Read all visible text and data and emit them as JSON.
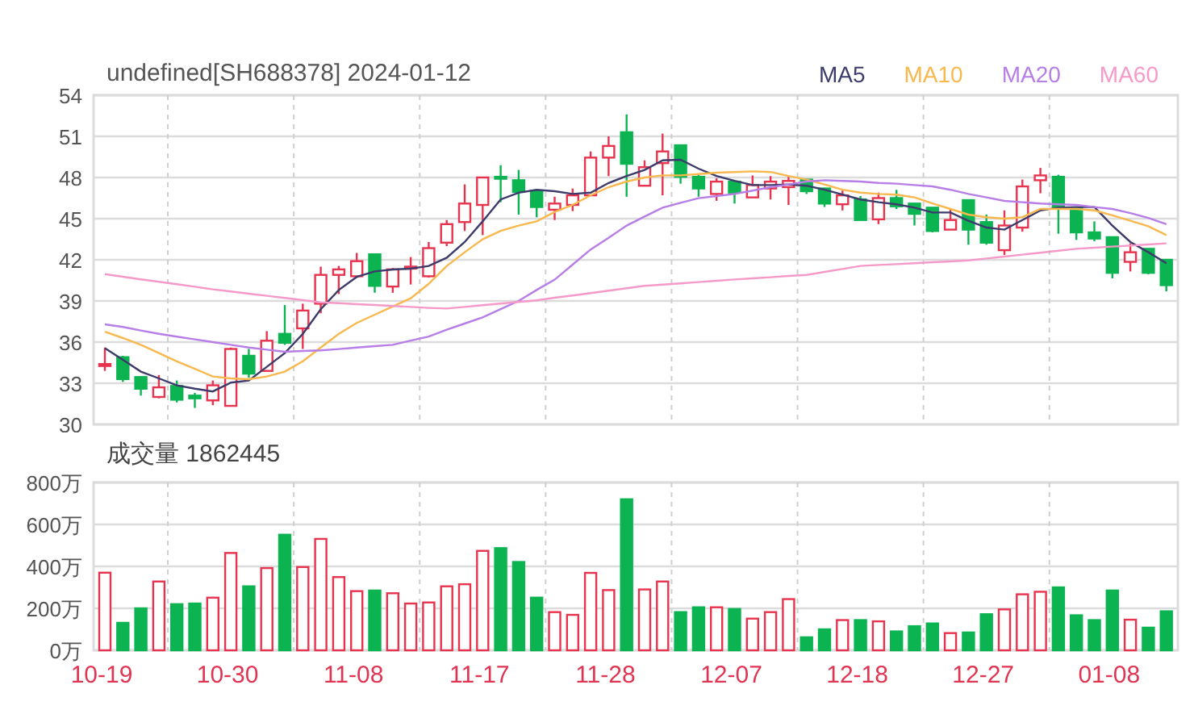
{
  "header": {
    "title": "undefined[SH688378] 2024-01-12"
  },
  "price_chart": {
    "chart_data": {
      "type": "candlestick",
      "grid": true,
      "categories": [
        null,
        null,
        null,
        null,
        null,
        null,
        null,
        null,
        null,
        null,
        null,
        null,
        null,
        null,
        null,
        null,
        null,
        null,
        null,
        null,
        null,
        null,
        null,
        null,
        null,
        null,
        null,
        null,
        null,
        null,
        null,
        null,
        null,
        null,
        null,
        null,
        null,
        null,
        null,
        null,
        null,
        null,
        null,
        null,
        null,
        null,
        null,
        null,
        null,
        null,
        null,
        null,
        null,
        null,
        null,
        null,
        null,
        null,
        null,
        null
      ],
      "ylim": [
        30,
        54
      ],
      "yticks": [
        30,
        33,
        36,
        39,
        42,
        45,
        48,
        51,
        54
      ],
      "series": [
        {
          "name": "MA5",
          "type": "line",
          "color": "#3d3b6b",
          "values": [
            35.55,
            34.7,
            33.85,
            33.35,
            32.85,
            32.6,
            32.4,
            33.05,
            33.2,
            34.2,
            35.2,
            36.6,
            38.4,
            39.8,
            40.75,
            41.15,
            41.3,
            41.35,
            41.55,
            42.15,
            43.3,
            44.8,
            46.4,
            46.9,
            47.1,
            47.0,
            46.8,
            46.9,
            47.6,
            48.1,
            48.55,
            49.25,
            49.3,
            48.65,
            48.1,
            47.75,
            47.45,
            47.45,
            47.5,
            47.4,
            47.1,
            46.75,
            46.4,
            46.2,
            46.05,
            45.8,
            45.45,
            45.45,
            44.85,
            44.35,
            44.2,
            44.9,
            45.6,
            45.8,
            45.85,
            45.85,
            44.5,
            43.3,
            42.55,
            41.75
          ]
        },
        {
          "name": "MA10",
          "type": "line",
          "color": "#f8b84e",
          "values": [
            36.75,
            36.3,
            35.8,
            35.2,
            34.6,
            34.05,
            33.5,
            33.35,
            33.3,
            33.5,
            33.85,
            34.6,
            35.6,
            36.6,
            37.4,
            38.0,
            38.6,
            39.2,
            40.25,
            41.55,
            42.55,
            43.5,
            44.1,
            44.5,
            44.8,
            45.5,
            46.0,
            46.7,
            47.3,
            47.7,
            48.0,
            48.15,
            48.15,
            48.25,
            48.35,
            48.4,
            48.45,
            48.4,
            48.1,
            47.85,
            47.5,
            47.1,
            46.9,
            46.8,
            46.75,
            46.55,
            46.1,
            45.7,
            45.3,
            45.1,
            45.0,
            45.1,
            45.7,
            45.7,
            45.7,
            45.6,
            45.25,
            44.85,
            44.45,
            43.8
          ]
        },
        {
          "name": "MA20",
          "type": "line",
          "color": "#b77ee8",
          "values": [
            37.3,
            37.1,
            36.85,
            36.6,
            36.4,
            36.2,
            36.0,
            35.8,
            35.6,
            35.45,
            35.3,
            35.35,
            35.4,
            35.5,
            35.6,
            35.7,
            35.8,
            36.1,
            36.4,
            36.9,
            37.35,
            37.8,
            38.4,
            39.0,
            39.8,
            40.55,
            41.65,
            42.75,
            43.6,
            44.5,
            45.15,
            45.8,
            46.15,
            46.5,
            46.65,
            46.8,
            47.05,
            47.3,
            47.5,
            47.7,
            47.8,
            47.75,
            47.7,
            47.6,
            47.55,
            47.45,
            47.35,
            47.1,
            46.8,
            46.55,
            46.3,
            46.2,
            46.1,
            46.05,
            46.0,
            45.85,
            45.7,
            45.4,
            45.05,
            44.6
          ]
        },
        {
          "name": "MA60",
          "type": "line",
          "color": "#f59ac8",
          "values": [
            40.95,
            40.77,
            40.58,
            40.4,
            40.22,
            40.03,
            39.85,
            39.69,
            39.53,
            39.38,
            39.22,
            39.06,
            38.9,
            38.83,
            38.77,
            38.7,
            38.63,
            38.57,
            38.5,
            38.45,
            38.57,
            38.69,
            38.81,
            38.93,
            39.05,
            39.23,
            39.4,
            39.58,
            39.75,
            39.93,
            40.1,
            40.19,
            40.28,
            40.38,
            40.47,
            40.56,
            40.65,
            40.73,
            40.82,
            40.9,
            41.12,
            41.33,
            41.55,
            41.62,
            41.68,
            41.75,
            41.82,
            41.88,
            41.95,
            42.09,
            42.23,
            42.38,
            42.52,
            42.66,
            42.8,
            42.88,
            42.96,
            43.04,
            43.12,
            43.2
          ]
        }
      ],
      "ohlc": [
        [
          34.3,
          35.6,
          33.9,
          34.4
        ],
        [
          34.9,
          35.0,
          33.1,
          33.3
        ],
        [
          33.45,
          33.5,
          32.1,
          32.6
        ],
        [
          32.0,
          33.6,
          31.9,
          32.7
        ],
        [
          32.8,
          33.2,
          31.6,
          31.8
        ],
        [
          32.1,
          32.3,
          31.2,
          31.9
        ],
        [
          31.75,
          33.2,
          31.4,
          32.85
        ],
        [
          31.35,
          35.6,
          31.3,
          35.5
        ],
        [
          35.0,
          35.5,
          33.4,
          33.7
        ],
        [
          33.9,
          36.8,
          33.85,
          36.1
        ],
        [
          36.6,
          38.7,
          35.8,
          35.95
        ],
        [
          37.0,
          38.8,
          35.5,
          38.3
        ],
        [
          38.8,
          41.5,
          38.1,
          40.9
        ],
        [
          40.9,
          41.55,
          39.5,
          41.3
        ],
        [
          40.8,
          42.5,
          40.7,
          41.9
        ],
        [
          42.4,
          42.45,
          39.6,
          40.1
        ],
        [
          40.05,
          41.4,
          39.6,
          41.3
        ],
        [
          41.4,
          42.2,
          40.2,
          41.5
        ],
        [
          40.8,
          43.3,
          40.7,
          42.85
        ],
        [
          43.25,
          44.9,
          43.0,
          44.6
        ],
        [
          44.75,
          47.5,
          44.1,
          46.1
        ],
        [
          46.0,
          48.05,
          43.8,
          48.0
        ],
        [
          48.05,
          48.9,
          46.2,
          47.95
        ],
        [
          47.8,
          48.55,
          45.3,
          46.95
        ],
        [
          47.05,
          47.1,
          45.1,
          45.85
        ],
        [
          45.65,
          46.6,
          44.9,
          46.1
        ],
        [
          46.0,
          47.2,
          45.55,
          46.7
        ],
        [
          46.7,
          49.9,
          46.7,
          49.45
        ],
        [
          49.45,
          51.0,
          48.1,
          50.3
        ],
        [
          51.3,
          52.6,
          46.6,
          49.0
        ],
        [
          47.4,
          49.25,
          47.4,
          48.75
        ],
        [
          49.05,
          51.2,
          46.7,
          49.9
        ],
        [
          50.35,
          50.4,
          47.55,
          48.05
        ],
        [
          48.05,
          48.2,
          46.6,
          47.2
        ],
        [
          46.8,
          47.95,
          46.3,
          47.7
        ],
        [
          47.7,
          47.75,
          46.1,
          46.9
        ],
        [
          46.55,
          48.15,
          46.55,
          47.45
        ],
        [
          47.2,
          48.1,
          46.4,
          47.7
        ],
        [
          47.3,
          48.05,
          46.0,
          47.75
        ],
        [
          47.85,
          47.9,
          46.8,
          47.0
        ],
        [
          47.2,
          47.25,
          45.85,
          46.1
        ],
        [
          46.05,
          47.05,
          45.6,
          46.7
        ],
        [
          46.4,
          46.65,
          44.9,
          44.9
        ],
        [
          44.95,
          46.9,
          44.6,
          46.5
        ],
        [
          46.5,
          47.1,
          45.7,
          45.9
        ],
        [
          46.1,
          46.15,
          44.5,
          45.35
        ],
        [
          45.8,
          45.8,
          44.0,
          44.1
        ],
        [
          44.2,
          45.65,
          44.2,
          44.9
        ],
        [
          46.35,
          46.35,
          43.1,
          44.2
        ],
        [
          44.75,
          45.3,
          43.1,
          43.25
        ],
        [
          42.7,
          45.6,
          42.35,
          44.5
        ],
        [
          44.35,
          47.85,
          44.05,
          47.35
        ],
        [
          47.8,
          48.7,
          46.85,
          48.15
        ],
        [
          48.05,
          48.2,
          43.9,
          45.8
        ],
        [
          45.8,
          45.85,
          43.45,
          44.0
        ],
        [
          44.0,
          44.8,
          43.35,
          43.55
        ],
        [
          43.65,
          43.65,
          40.65,
          41.05
        ],
        [
          41.85,
          43.2,
          41.15,
          42.55
        ],
        [
          42.8,
          42.8,
          40.95,
          41.05
        ],
        [
          42.0,
          42.0,
          39.7,
          40.15
        ]
      ]
    }
  },
  "volume_chart": {
    "title": "成交量 1862445",
    "chart_data": {
      "type": "bar",
      "grid": true,
      "categories": [
        "10-19",
        null,
        null,
        null,
        null,
        null,
        null,
        "10-30",
        null,
        null,
        null,
        null,
        null,
        null,
        "11-08",
        null,
        null,
        null,
        null,
        null,
        null,
        "11-17",
        null,
        null,
        null,
        null,
        null,
        null,
        "11-28",
        null,
        null,
        null,
        null,
        null,
        null,
        "12-07",
        null,
        null,
        null,
        null,
        null,
        null,
        "12-18",
        null,
        null,
        null,
        null,
        null,
        null,
        "12-27",
        null,
        null,
        null,
        null,
        null,
        null,
        "01-08",
        null,
        null,
        null
      ],
      "ylim": [
        0,
        800
      ],
      "yticks": [
        {
          "value": 0,
          "label": "0万"
        },
        {
          "value": 200,
          "label": "200万"
        },
        {
          "value": 400,
          "label": "400万"
        },
        {
          "value": 600,
          "label": "600万"
        },
        {
          "value": 800,
          "label": "800万"
        }
      ],
      "values": [
        370,
        131,
        200,
        328,
        220,
        223,
        251,
        464,
        305,
        392,
        551,
        397,
        531,
        349,
        282,
        285,
        272,
        223,
        228,
        305,
        315,
        474,
        487,
        421,
        251,
        182,
        169,
        369,
        287,
        720,
        290,
        328,
        182,
        205,
        205,
        197,
        151,
        182,
        244,
        62,
        100,
        144,
        144,
        138,
        90,
        115,
        128,
        82,
        85,
        172,
        195,
        267,
        279,
        300,
        167,
        144,
        285,
        146,
        108,
        186
      ]
    }
  }
}
